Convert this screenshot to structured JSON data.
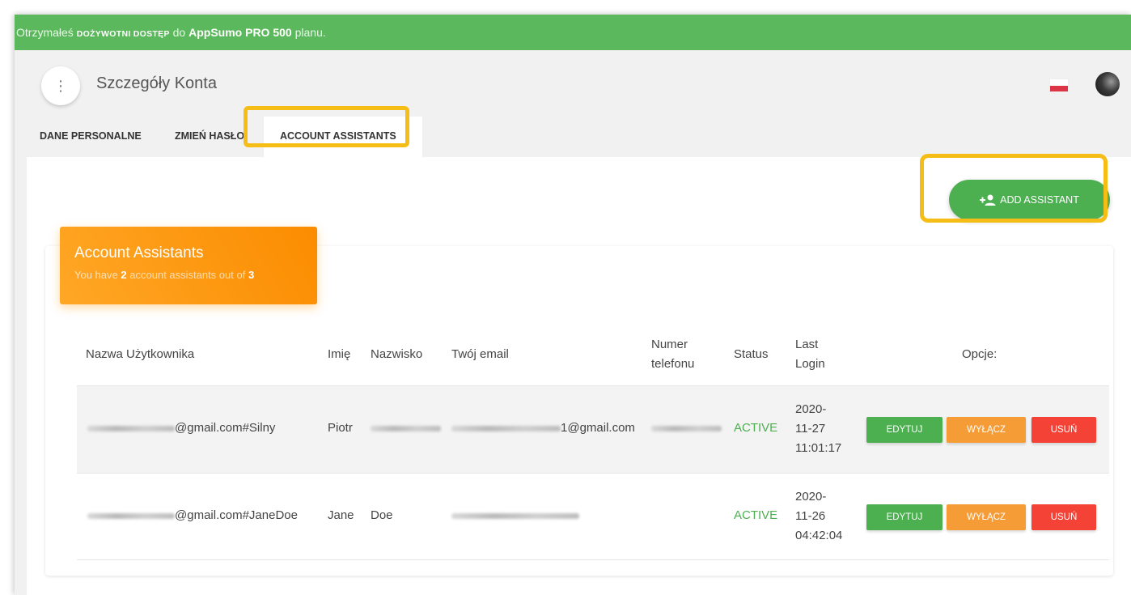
{
  "banner": {
    "prefix": "Otrzymałeś",
    "access": "DOŻYWOTNI DOSTĘP",
    "mid": "do",
    "plan": "AppSumo PRO 500",
    "suffix": "planu."
  },
  "header": {
    "menu_icon": "more-vertical-icon",
    "title": "Szczegóły Konta"
  },
  "tabs": [
    {
      "label": "DANE PERSONALNE"
    },
    {
      "label": "ZMIEŃ HASŁO"
    },
    {
      "label": "ACCOUNT ASSISTANTS",
      "active": true
    }
  ],
  "add_button": {
    "label": "ADD ASSISTANT",
    "icon": "person-add-icon"
  },
  "card": {
    "title": "Account Assistants",
    "sub_prefix": "You have",
    "count": "2",
    "sub_mid": "account assistants out of",
    "max": "3"
  },
  "table": {
    "headers": {
      "username": "Nazwa Użytkownika",
      "first": "Imię",
      "last": "Nazwisko",
      "email": "Twój email",
      "phone_1": "Numer",
      "phone_2": "telefonu",
      "status": "Status",
      "login_1": "Last",
      "login_2": "Login",
      "options": "Opcje:"
    },
    "rows": [
      {
        "username_suffix": "@gmail.com#Silny",
        "first": "Piotr",
        "email_suffix": "1@gmail.com",
        "status": "ACTIVE",
        "login_1": "2020-",
        "login_2": "11-27",
        "login_3": "11:01:17",
        "edit": "EDYTUJ",
        "disable": "WYŁĄCZ",
        "delete": "USUŃ"
      },
      {
        "username_suffix": "@gmail.com#JaneDoe",
        "first": "Jane",
        "last": "Doe",
        "status": "ACTIVE",
        "login_1": "2020-",
        "login_2": "11-26",
        "login_3": "04:42:04",
        "edit": "EDYTUJ",
        "disable": "WYŁĄCZ",
        "delete": "USUŃ"
      }
    ]
  },
  "colors": {
    "banner": "#5cb85c",
    "accent_green": "#4caf50",
    "card_header_orange": "#fb8c00",
    "disable_orange": "#f59c37",
    "delete_red": "#f44336",
    "highlight_yellow": "#f6bd16"
  }
}
